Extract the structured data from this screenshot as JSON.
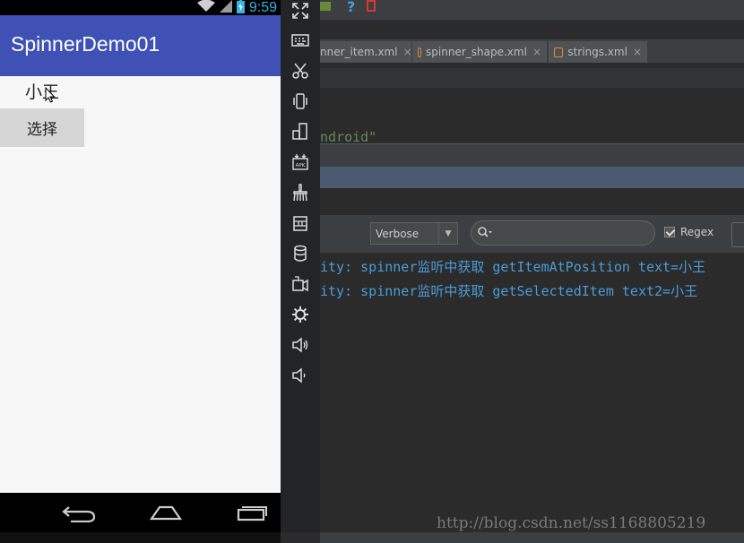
{
  "status_bar": {
    "time": "9:59"
  },
  "app": {
    "title": "SpinnerDemo01",
    "spinner_value": "小王",
    "select_button": "选择"
  },
  "emulator_toolbar": {
    "tools": [
      "fullscreen-icon",
      "keyboard-icon",
      "scissors-icon",
      "vibrate-icon",
      "rotate-icon",
      "apk-install-icon",
      "clean-icon",
      "usb-icon",
      "storage-icon",
      "camera-icon",
      "settings-icon",
      "volume-up-icon",
      "volume-down-icon"
    ]
  },
  "ide": {
    "tabs": [
      {
        "label": "nner_item.xml"
      },
      {
        "label": "spinner_shape.xml"
      },
      {
        "label": "strings.xml"
      }
    ],
    "code_fragment": "ndroid\"",
    "log_level": "Verbose",
    "search_placeholder": "",
    "regex_label": "Regex",
    "log_lines": [
      "ity:  spinner监听中获取 getItemAtPosition text=小王",
      "ity:  spinner监听中获取 getSelectedItem text2=小王"
    ],
    "watermark": "http://blog.csdn.net/ss1168805219"
  },
  "colors": {
    "app_bar": "#3f51b5",
    "log_text": "#4b9bd8",
    "ide_bg": "#2b2b2b"
  }
}
